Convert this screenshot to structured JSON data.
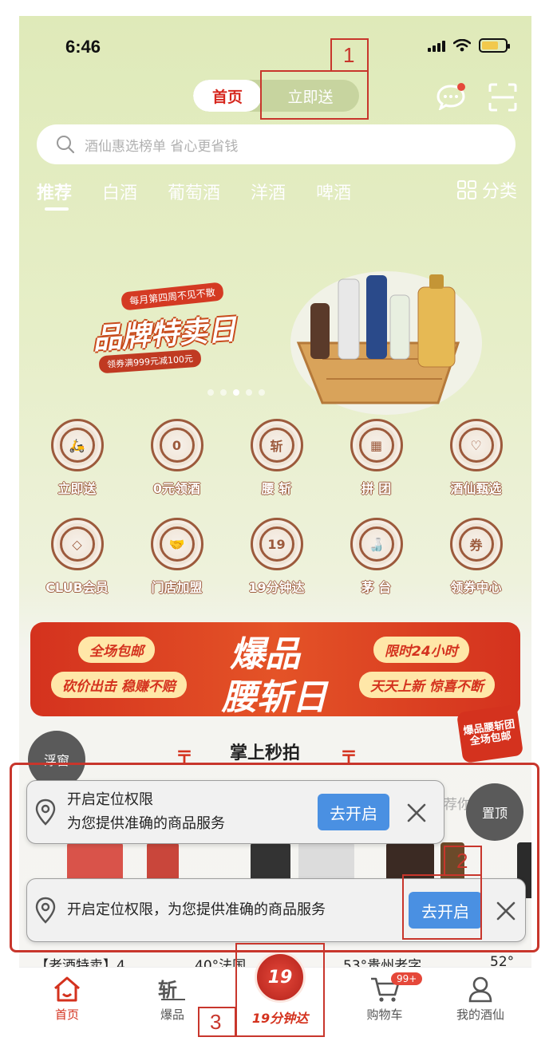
{
  "status": {
    "time": "6:46"
  },
  "header": {
    "tab_home": "首页",
    "tab_now": "立即送"
  },
  "search": {
    "placeholder": "酒仙惠选榜单 省心更省钱"
  },
  "categories": {
    "items": [
      "推荐",
      "白酒",
      "葡萄酒",
      "洋酒",
      "啤酒"
    ],
    "more": "分类"
  },
  "banner": {
    "sub": "每月第四周不见不散",
    "title": "品牌特卖日",
    "coupon": "领券满999元减100元"
  },
  "grid": [
    {
      "label": "立即送",
      "icon": "delivery-scooter-icon",
      "glyph": "🛵"
    },
    {
      "label": "0元领酒",
      "icon": "zero-icon",
      "glyph": "0"
    },
    {
      "label": "腰 斩",
      "icon": "cut-icon",
      "glyph": "斩"
    },
    {
      "label": "拼 团",
      "icon": "group-grid-icon",
      "glyph": "▦"
    },
    {
      "label": "酒仙甄选",
      "icon": "heart-icon",
      "glyph": "♡"
    },
    {
      "label": "CLUB会员",
      "icon": "diamond-icon",
      "glyph": "◇"
    },
    {
      "label": "门店加盟",
      "icon": "handshake-icon",
      "glyph": "🤝"
    },
    {
      "label": "19分钟达",
      "icon": "nineteen-min-icon",
      "glyph": "19"
    },
    {
      "label": "茅 台",
      "icon": "bottle-icon",
      "glyph": "🍶"
    },
    {
      "label": "领券中心",
      "icon": "coupon-icon",
      "glyph": "券"
    }
  ],
  "promo": {
    "left1": "全场包邮",
    "left2": "砍价出击 稳赚不赔",
    "mid1": "爆品",
    "mid2": "腰斩日",
    "right1": "限时24小时",
    "right2": "天天上新 惊喜不断",
    "badge": "爆品腰斩团全场包邮"
  },
  "section": {
    "title": "掌上秒拍"
  },
  "floating": {
    "float_window": "浮窗",
    "to_top": "置顶"
  },
  "permission_popup_1": {
    "line1": "开启定位权限",
    "line2": "为您提供准确的商品服务",
    "button": "去开启"
  },
  "permission_popup_2": {
    "text": "开启定位权限，为您提供准确的商品服务",
    "button": "去开启"
  },
  "hidden_text": {
    "partial": "荐你"
  },
  "product_titles": [
    "【老酒特卖】4",
    "40°法国",
    "53°贵州老字",
    "52°"
  ],
  "tabbar": {
    "home": "首页",
    "hot": "爆品",
    "nineteen": "19分钟达",
    "nineteen_badge": "19",
    "cart": "购物车",
    "cart_badge": "99+",
    "mine": "我的酒仙"
  },
  "annotations": {
    "n1": "1",
    "n2": "2",
    "n3": "3"
  },
  "colors": {
    "brand_red": "#d4321e",
    "annotation_red": "#c8362c",
    "button_blue": "#4a90e2"
  }
}
